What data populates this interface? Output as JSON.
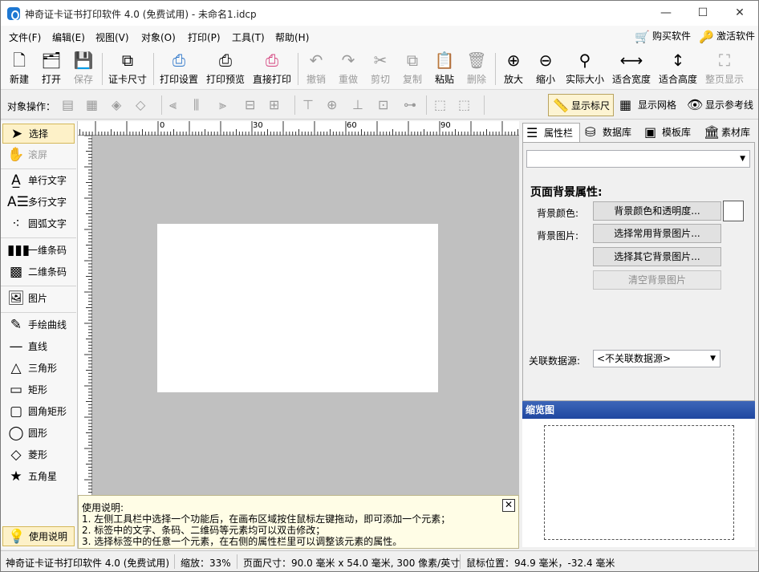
{
  "window": {
    "title": "神奇证卡证书打印软件 4.0 (免费试用) - 未命名1.idcp",
    "min": "—",
    "max": "☐",
    "close": "✕"
  },
  "menu": [
    "文件(F)",
    "编辑(E)",
    "视图(V)",
    "对象(O)",
    "打印(P)",
    "工具(T)",
    "帮助(H)"
  ],
  "menu_right": {
    "buy": "购买软件",
    "activate": "激活软件"
  },
  "toolbar": {
    "new": "新建",
    "open": "打开",
    "save": "保存",
    "card_size": "证卡尺寸",
    "print_settings": "打印设置",
    "print_preview": "打印预览",
    "direct_print": "直接打印",
    "undo": "撤销",
    "redo": "重做",
    "cut": "剪切",
    "copy": "复制",
    "paste": "粘贴",
    "delete": "删除",
    "zoom_in": "放大",
    "zoom_out": "缩小",
    "actual_size": "实际大小",
    "fit_width": "适合宽度",
    "fit_height": "适合高度",
    "fit_page": "整页显示"
  },
  "toolbar2": {
    "label": "对象操作：",
    "show_ruler": "显示标尺",
    "show_grid": "显示网格",
    "show_guides": "显示参考线"
  },
  "tools": {
    "select": "选择",
    "scroll": "滚屏",
    "single_text": "单行文字",
    "multi_text": "多行文字",
    "arc_text": "圆弧文字",
    "barcode": "一维条码",
    "qrcode": "二维条码",
    "image": "图片",
    "freehand": "手绘曲线",
    "line": "直线",
    "triangle": "三角形",
    "rect": "矩形",
    "round_rect": "圆角矩形",
    "ellipse": "圆形",
    "diamond": "菱形",
    "star": "五角星",
    "help": "使用说明"
  },
  "ruler": {
    "h": [
      "0",
      "30",
      "60",
      "90"
    ]
  },
  "help": {
    "title": "使用说明:",
    "l1": "1. 左侧工具栏中选择一个功能后，在画布区域按住鼠标左键拖动，即可添加一个元素；",
    "l2": "2. 标签中的文字、条码、二维码等元素均可以双击修改；",
    "l3": "3. 选择标签中的任意一个元素，在右侧的属性栏里可以调整该元素的属性。",
    "close": "✕"
  },
  "right": {
    "tabs": [
      "属性栏",
      "数据库",
      "模板库",
      "素材库"
    ],
    "combo": "",
    "section_title": "页面背景属性:",
    "bg_color_label": "背景颜色:",
    "bg_color_btn": "背景颜色和透明度...",
    "bg_image_label": "背景图片:",
    "bg_common_btn": "选择常用背景图片...",
    "bg_other_btn": "选择其它背景图片...",
    "bg_clear_btn": "清空背景图片",
    "datasource_label": "关联数据源:",
    "datasource_value": "<不关联数据源>",
    "thumb_title": "缩览图"
  },
  "status": {
    "app": "神奇证卡证书打印软件 4.0 (免费试用)",
    "zoom": "缩放：33%",
    "pagesize": "页面尺寸：90.0 毫米 x 54.0 毫米, 300 像素/英寸",
    "mouse": "鼠标位置：94.9 毫米，-32.4 毫米"
  },
  "colors": {
    "selected_bg": "#fdf1c8",
    "thumb_header": "#2b55ac",
    "canvas": "#c0c0c0"
  }
}
